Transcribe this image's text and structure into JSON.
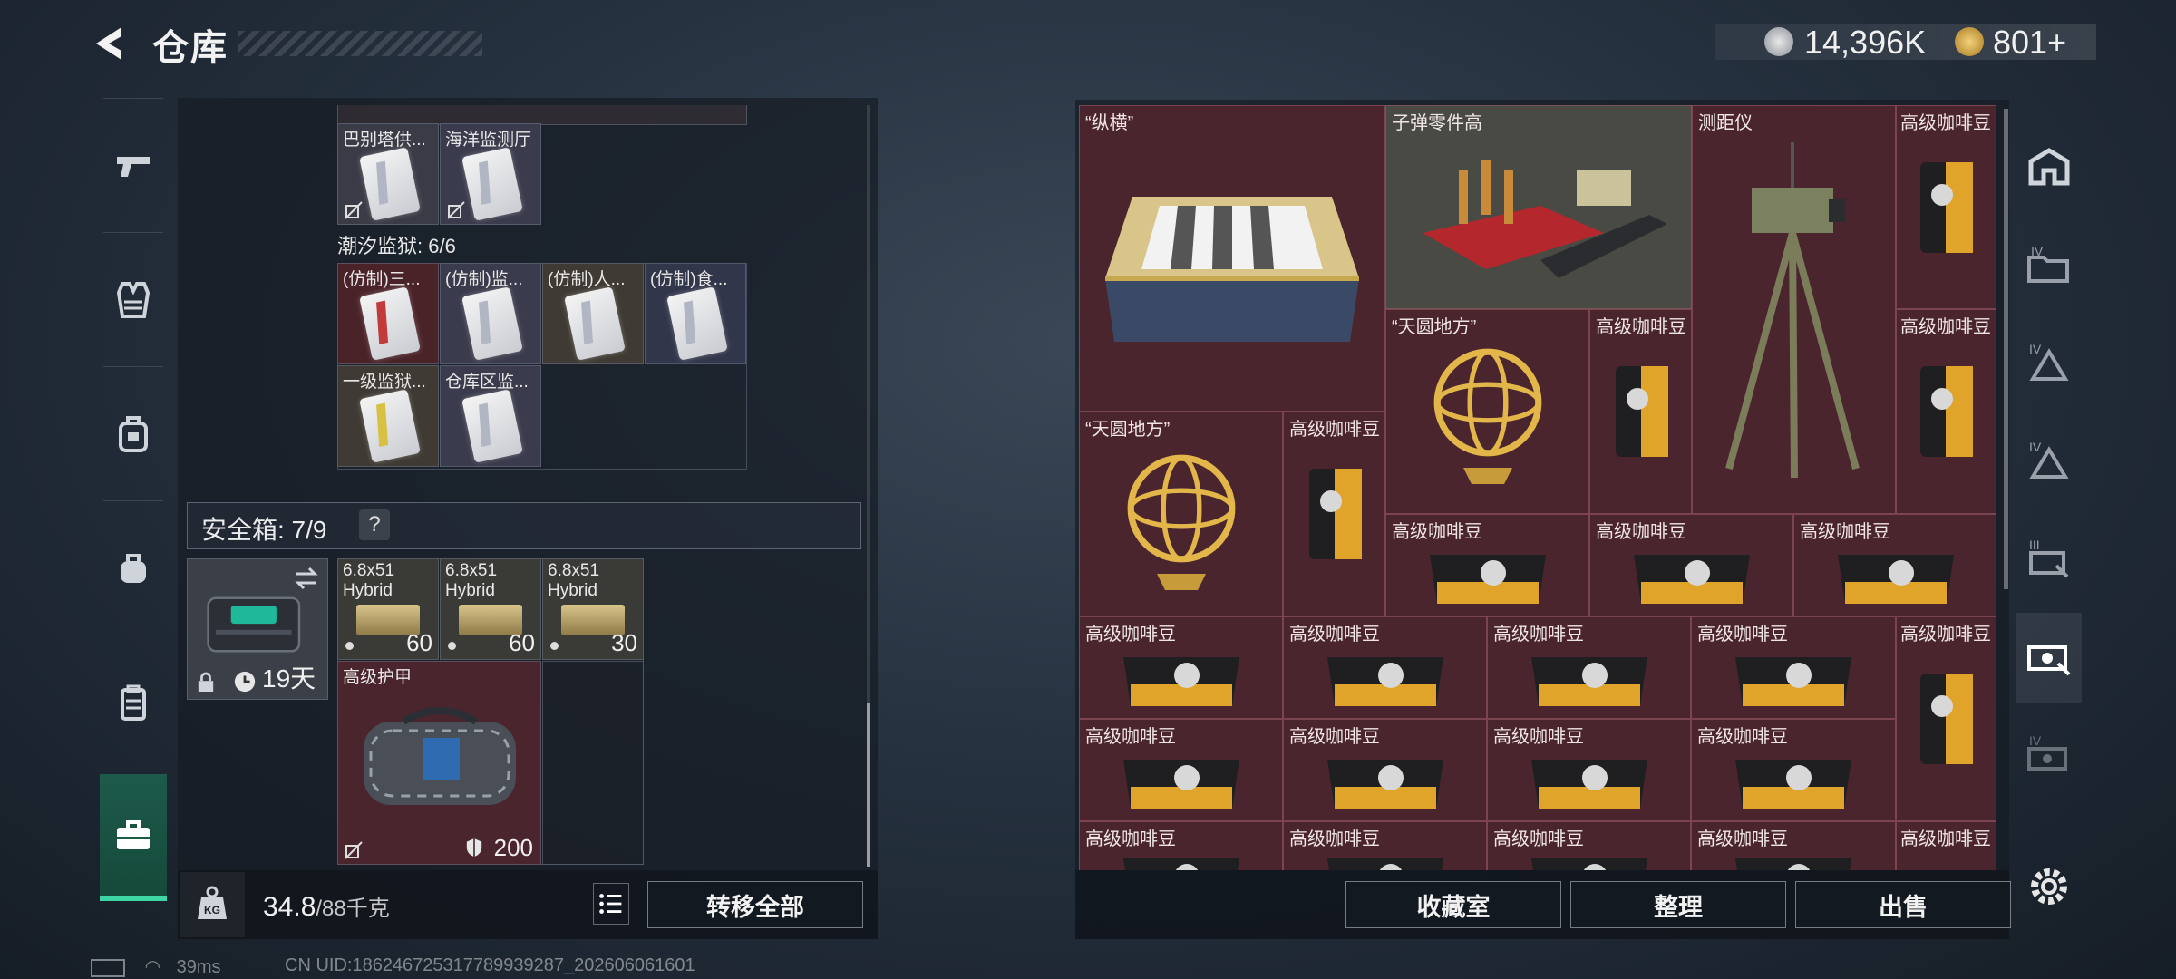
{
  "header": {
    "title": "仓库"
  },
  "currency": {
    "silver": "14,396K",
    "gold": "801+"
  },
  "left": {
    "group1": {
      "items": [
        "巴别塔供...",
        "海洋监测厅"
      ]
    },
    "group2": {
      "title": "潮汐监狱: 6/6",
      "items": [
        "(仿制)三...",
        "(仿制)监...",
        "(仿制)人...",
        "(仿制)食...",
        "一级监狱...",
        "仓库区监..."
      ]
    },
    "safebox": {
      "label": "安全箱: 7/9",
      "help": "?",
      "duration": "19天"
    },
    "ammo": [
      {
        "cal": "6.8x51",
        "type": "Hybrid",
        "count": "60"
      },
      {
        "cal": "6.8x51",
        "type": "Hybrid",
        "count": "60"
      },
      {
        "cal": "6.8x51",
        "type": "Hybrid",
        "count": "30"
      }
    ],
    "armor": {
      "name": "高级护甲",
      "durability": "200"
    },
    "weight": {
      "current": "34.8",
      "max": "/88千克"
    },
    "transfer_all": "转移全部"
  },
  "right": {
    "items": {
      "chess": "“纵横”",
      "bullet_parts": "子弹零件高",
      "rangefinder": "测距仪",
      "coffee": "高级咖啡豆",
      "armillary": "“天圆地方”"
    },
    "buttons": {
      "collection": "收藏室",
      "organize": "整理",
      "sell": "出售"
    }
  },
  "status": {
    "ping": "39ms",
    "uid": "CN UID:186246725317789939287_202606061601"
  },
  "colors": {
    "accent": "#3fd6a6",
    "cell_bg": "#4b252d"
  }
}
